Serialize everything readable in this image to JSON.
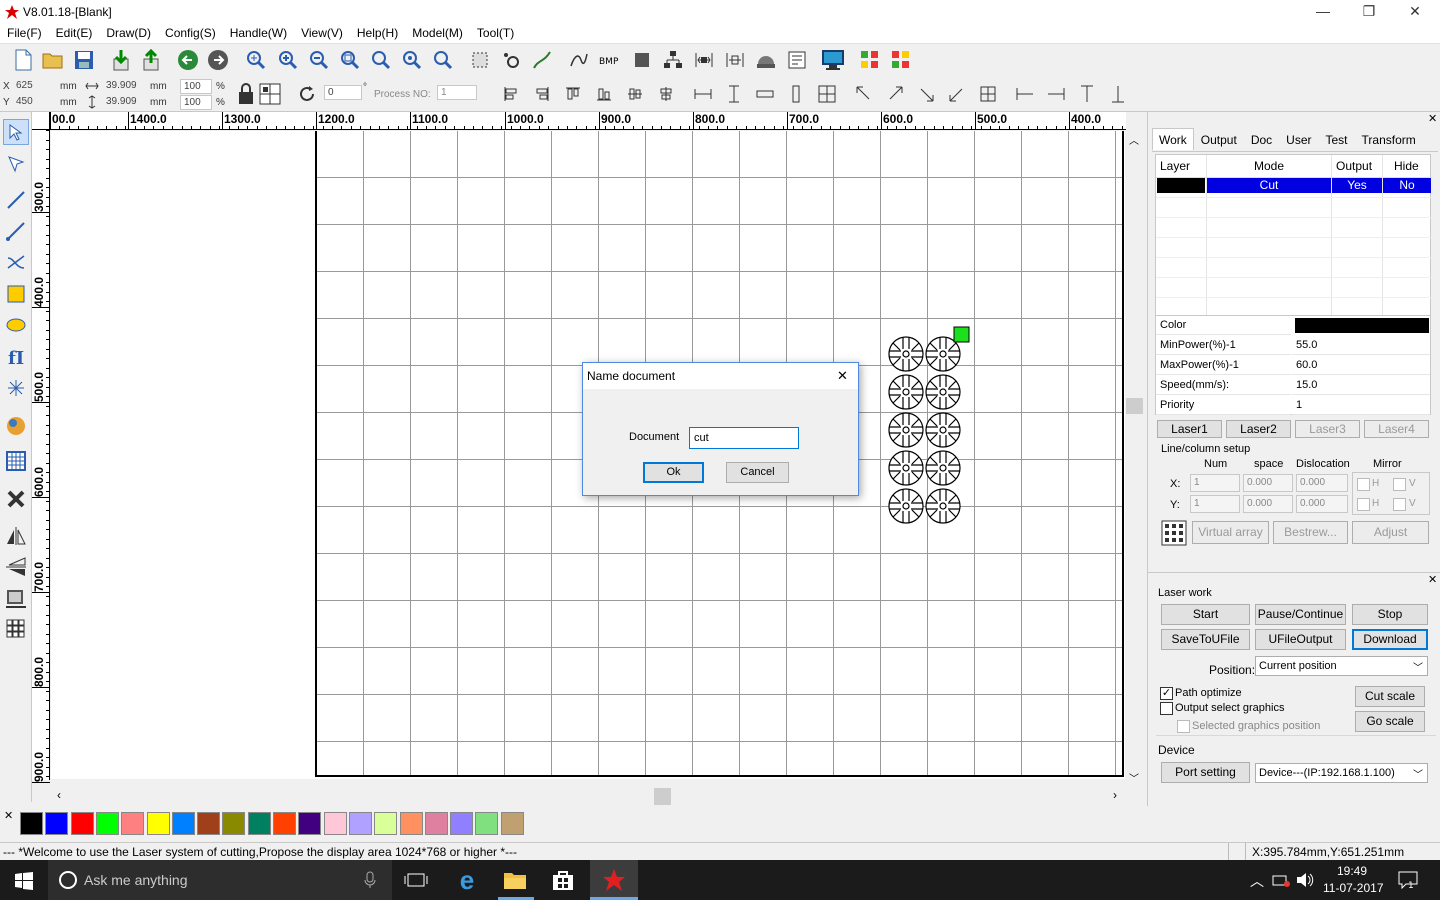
{
  "title": "V8.01.18-[Blank]",
  "window_controls": {
    "minimize": "—",
    "restore": "❐",
    "close": "✕"
  },
  "menu": [
    "File(F)",
    "Edit(E)",
    "Draw(D)",
    "Config(S)",
    "Handle(W)",
    "View(V)",
    "Help(H)",
    "Model(M)",
    "Tool(T)"
  ],
  "coords": {
    "x_label": "X",
    "x_value": "625",
    "y_label": "Y",
    "y_value": "450",
    "unit": "mm",
    "w_value": "39.909",
    "h_value": "39.909",
    "w_pct": "100",
    "h_pct": "100",
    "pct": "%",
    "rotation": "0",
    "deg": "°",
    "process_label": "Process NO:",
    "process_no": "1"
  },
  "ruler_h": [
    "00.0",
    "1400.0",
    "1300.0",
    "1200.0",
    "1100.0",
    "1000.0",
    "900.0",
    "800.0",
    "700.0",
    "600.0",
    "500.0",
    "400.0"
  ],
  "ruler_v": [
    "300.0",
    "400.0",
    "500.0",
    "600.0",
    "700.0",
    "800.0",
    "900.0"
  ],
  "dialog": {
    "title": "Name document",
    "label": "Document",
    "value": "cut",
    "ok": "Ok",
    "cancel": "Cancel",
    "close": "✕"
  },
  "panel": {
    "tabs": [
      "Work",
      "Output",
      "Doc",
      "User",
      "Test",
      "Transform"
    ],
    "close": "✕",
    "layer_headers": [
      "Layer",
      "Mode",
      "Output",
      "Hide"
    ],
    "layer_row": {
      "color": "#000000",
      "mode": "Cut",
      "output": "Yes",
      "hide": "No"
    },
    "props": [
      [
        "Color",
        ""
      ],
      [
        "MinPower(%)-1",
        "55.0"
      ],
      [
        "MaxPower(%)-1",
        "60.0"
      ],
      [
        "Speed(mm/s):",
        "15.0"
      ],
      [
        "Priority",
        "1"
      ]
    ],
    "lasers": [
      "Laser1",
      "Laser2",
      "Laser3",
      "Laser4"
    ],
    "linecol_title": "Line/column setup",
    "linecol_headers": [
      "Num",
      "space",
      "Dislocation",
      "Mirror"
    ],
    "x_label": "X:",
    "y_label": "Y:",
    "x_vals": [
      "1",
      "0.000",
      "0.000"
    ],
    "y_vals": [
      "1",
      "0.000",
      "0.000"
    ],
    "mirror_h": "H",
    "mirror_v": "V",
    "array_buttons": [
      "Virtual array",
      "Bestrew...",
      "Adjust"
    ]
  },
  "laser_work": {
    "title": "Laser work",
    "close": "✕",
    "buttons": [
      "Start",
      "Pause/Continue",
      "Stop",
      "SaveToUFile",
      "UFileOutput",
      "Download"
    ],
    "position_label": "Position:",
    "position_value": "Current position",
    "path_optimize": "Path optimize",
    "output_select": "Output select graphics",
    "selected_pos": "Selected graphics position",
    "cut_scale": "Cut scale",
    "go_scale": "Go scale",
    "device_label": "Device",
    "port_setting": "Port setting",
    "device_value": "Device---(IP:192.168.1.100)"
  },
  "palette_colors": [
    "#000000",
    "#0000ff",
    "#ff0000",
    "#00ff00",
    "#ff8080",
    "#ffff00",
    "#0080ff",
    "#a0401a",
    "#8a8a00",
    "#008060",
    "#ff4000",
    "#400080",
    "#ffc8d8",
    "#b0a0ff",
    "#d8ff98",
    "#ff9060",
    "#e080a0",
    "#9080ff",
    "#80e080",
    "#c0a070"
  ],
  "status": {
    "message": "--- *Welcome to use the Laser system of cutting,Propose the display area 1024*768 or higher *---",
    "coords": "X:395.784mm,Y:651.251mm"
  },
  "taskbar": {
    "search": "Ask me anything",
    "time": "19:49",
    "date": "11-07-2017"
  }
}
